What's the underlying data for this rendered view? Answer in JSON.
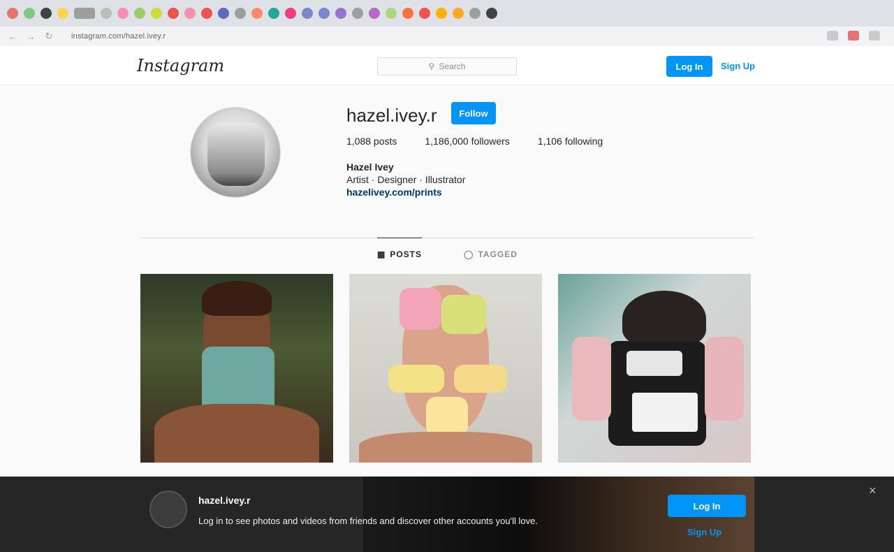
{
  "browser": {
    "url": "instagram.com/hazel.ivey.r",
    "tab_colors": [
      "#e57373",
      "#81c784",
      "#424242",
      "#ffd54f",
      "#9e9e9e",
      "#bdbdbd",
      "#f48fb1",
      "#9ccc65",
      "#cddc39",
      "#ef5350",
      "#f48fb1",
      "#ef5350",
      "#5c6bc0",
      "#9e9e9e",
      "#ff8a65",
      "#26a69a",
      "#ec407a",
      "#7986cb",
      "#7986cb",
      "#9575cd",
      "#9e9e9e",
      "#ba68c8",
      "#aed581",
      "#ff7043",
      "#ef5350",
      "#ffb300",
      "#ffa726",
      "#9e9e9e",
      "#424242"
    ]
  },
  "header": {
    "logo": "Instagram",
    "search_placeholder": "Search",
    "login_label": "Log In",
    "signup_label": "Sign Up"
  },
  "profile": {
    "username": "hazel.ivey.r",
    "follow_label": "Follow",
    "posts": "1,088 posts",
    "followers": "1,186,000 followers",
    "following": "1,106 following",
    "full_name": "Hazel Ivey",
    "category": "Artist · Designer · Illustrator",
    "link": "hazelivey.com/prints"
  },
  "tabs": [
    {
      "label": "POSTS"
    },
    {
      "label": "TAGGED"
    }
  ],
  "banner": {
    "title": "hazel.ivey.r",
    "text": "Log in to see photos and videos from friends and discover other accounts you'll love.",
    "login_label": "Log In",
    "signup_label": "Sign Up",
    "close": "×"
  }
}
